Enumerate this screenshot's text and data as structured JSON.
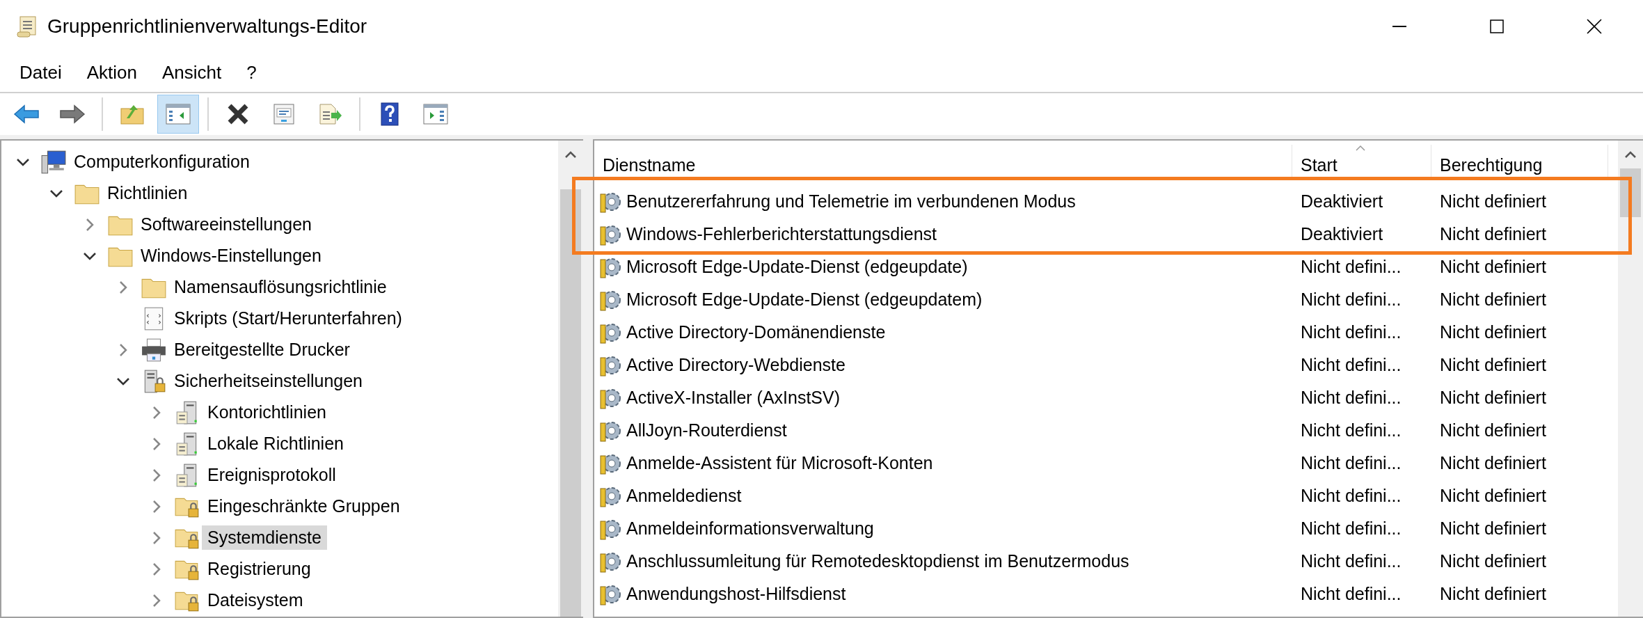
{
  "window": {
    "title": "Gruppenrichtlinienverwaltungs-Editor"
  },
  "menu": [
    "Datei",
    "Aktion",
    "Ansicht",
    "?"
  ],
  "toolbar": [
    {
      "kind": "back",
      "pressed": false
    },
    {
      "kind": "forward",
      "pressed": false
    },
    {
      "kind": "separator"
    },
    {
      "kind": "up",
      "pressed": false
    },
    {
      "kind": "tree",
      "pressed": true
    },
    {
      "kind": "separator"
    },
    {
      "kind": "delete",
      "pressed": false
    },
    {
      "kind": "properties",
      "pressed": false
    },
    {
      "kind": "export",
      "pressed": false
    },
    {
      "kind": "separator"
    },
    {
      "kind": "help",
      "pressed": false
    },
    {
      "kind": "actionpane",
      "pressed": false
    }
  ],
  "tree": [
    {
      "label": "Computerkonfiguration",
      "kind": "computer",
      "expandable": true,
      "expanded": true,
      "selected": false,
      "children": [
        {
          "label": "Richtlinien",
          "kind": "folder",
          "expandable": true,
          "expanded": true,
          "selected": false,
          "children": [
            {
              "label": "Softwareeinstellungen",
              "kind": "folder",
              "expandable": true,
              "expanded": false,
              "selected": false
            },
            {
              "label": "Windows-Einstellungen",
              "kind": "folder",
              "expandable": true,
              "expanded": true,
              "selected": false,
              "children": [
                {
                  "label": "Namensauflösungsrichtlinie",
                  "kind": "folder",
                  "expandable": true,
                  "expanded": false,
                  "selected": false
                },
                {
                  "label": "Skripts (Start/Herunterfahren)",
                  "kind": "script",
                  "expandable": false,
                  "expanded": false,
                  "selected": false
                },
                {
                  "label": "Bereitgestellte Drucker",
                  "kind": "printer",
                  "expandable": true,
                  "expanded": false,
                  "selected": false
                },
                {
                  "label": "Sicherheitseinstellungen",
                  "kind": "security",
                  "expandable": true,
                  "expanded": true,
                  "selected": false,
                  "children": [
                    {
                      "label": "Kontorichtlinien",
                      "kind": "server",
                      "expandable": true,
                      "expanded": false,
                      "selected": false
                    },
                    {
                      "label": "Lokale Richtlinien",
                      "kind": "server",
                      "expandable": true,
                      "expanded": false,
                      "selected": false
                    },
                    {
                      "label": "Ereignisprotokoll",
                      "kind": "server",
                      "expandable": true,
                      "expanded": false,
                      "selected": false
                    },
                    {
                      "label": "Eingeschränkte Gruppen",
                      "kind": "lockfolder",
                      "expandable": true,
                      "expanded": false,
                      "selected": false
                    },
                    {
                      "label": "Systemdienste",
                      "kind": "lockfolder",
                      "expandable": true,
                      "expanded": false,
                      "selected": true
                    },
                    {
                      "label": "Registrierung",
                      "kind": "lockfolder",
                      "expandable": true,
                      "expanded": false,
                      "selected": false
                    },
                    {
                      "label": "Dateisystem",
                      "kind": "lockfolder",
                      "expandable": true,
                      "expanded": false,
                      "selected": false
                    }
                  ]
                }
              ]
            }
          ]
        }
      ]
    }
  ],
  "list": {
    "columns": [
      {
        "label": "Dienstname",
        "sorted": false
      },
      {
        "label": "Start",
        "sorted": true
      },
      {
        "label": "Berechtigung",
        "sorted": false
      }
    ],
    "rows": [
      {
        "name": "Benutzererfahrung und Telemetrie im verbundenen Modus",
        "start": "Deaktiviert",
        "permission": "Nicht definiert",
        "highlighted": true
      },
      {
        "name": "Windows-Fehlerberichterstattungsdienst",
        "start": "Deaktiviert",
        "permission": "Nicht definiert",
        "highlighted": true
      },
      {
        "name": "Microsoft Edge-Update-Dienst (edgeupdate)",
        "start": "Nicht defini...",
        "permission": "Nicht definiert",
        "highlighted": false
      },
      {
        "name": "Microsoft Edge-Update-Dienst (edgeupdatem)",
        "start": "Nicht defini...",
        "permission": "Nicht definiert",
        "highlighted": false
      },
      {
        "name": "Active Directory-Domänendienste",
        "start": "Nicht defini...",
        "permission": "Nicht definiert",
        "highlighted": false
      },
      {
        "name": "Active Directory-Webdienste",
        "start": "Nicht defini...",
        "permission": "Nicht definiert",
        "highlighted": false
      },
      {
        "name": "ActiveX-Installer (AxInstSV)",
        "start": "Nicht defini...",
        "permission": "Nicht definiert",
        "highlighted": false
      },
      {
        "name": "AllJoyn-Routerdienst",
        "start": "Nicht defini...",
        "permission": "Nicht definiert",
        "highlighted": false
      },
      {
        "name": "Anmelde-Assistent für Microsoft-Konten",
        "start": "Nicht defini...",
        "permission": "Nicht definiert",
        "highlighted": false
      },
      {
        "name": "Anmeldedienst",
        "start": "Nicht defini...",
        "permission": "Nicht definiert",
        "highlighted": false
      },
      {
        "name": "Anmeldeinformationsverwaltung",
        "start": "Nicht defini...",
        "permission": "Nicht definiert",
        "highlighted": false
      },
      {
        "name": "Anschlussumleitung für Remotedesktopdienst im Benutzermodus",
        "start": "Nicht defini...",
        "permission": "Nicht definiert",
        "highlighted": false
      },
      {
        "name": "Anwendungshost-Hilfsdienst",
        "start": "Nicht defini...",
        "permission": "Nicht definiert",
        "highlighted": false
      }
    ]
  }
}
